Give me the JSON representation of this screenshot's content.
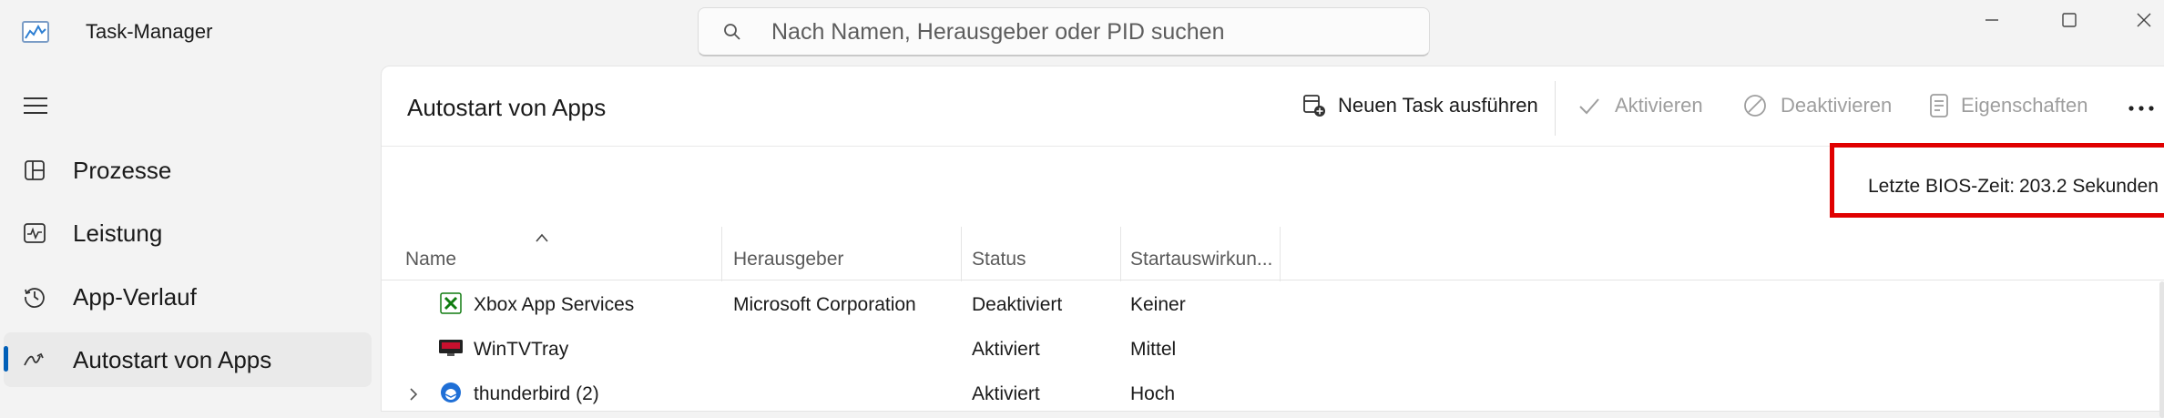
{
  "app": {
    "title": "Task-Manager",
    "icon": "task-manager-icon"
  },
  "search": {
    "placeholder": "Nach Namen, Herausgeber oder PID suchen"
  },
  "window_controls": [
    "minimize-icon",
    "maximize-icon",
    "close-icon"
  ],
  "sidebar": {
    "items": [
      {
        "label": "Prozesse",
        "icon": "processes-icon"
      },
      {
        "label": "Leistung",
        "icon": "performance-icon"
      },
      {
        "label": "App-Verlauf",
        "icon": "history-icon"
      },
      {
        "label": "Autostart von Apps",
        "icon": "startup-icon",
        "active": true
      }
    ]
  },
  "main": {
    "title": "Autostart von Apps",
    "toolbar": {
      "new_task": "Neuen Task ausführen",
      "enable": "Aktivieren",
      "disable": "Deaktivieren",
      "properties": "Eigenschaften"
    },
    "bios": {
      "label": "Letzte BIOS-Zeit:",
      "value": "203.2 Sekunden"
    },
    "table": {
      "columns": [
        "Name",
        "Herausgeber",
        "Status",
        "Startauswirkun..."
      ],
      "rows": [
        {
          "name": "Xbox App Services",
          "publisher": "Microsoft Corporation",
          "status": "Deaktiviert",
          "impact": "Keiner"
        },
        {
          "name": "WinTVTray",
          "publisher": "",
          "status": "Aktiviert",
          "impact": "Mittel"
        },
        {
          "name": "thunderbird (2)",
          "publisher": "",
          "status": "Aktiviert",
          "impact": "Hoch"
        }
      ]
    }
  },
  "colors": {
    "accent": "#005fb8",
    "highlight": "#e00000"
  }
}
